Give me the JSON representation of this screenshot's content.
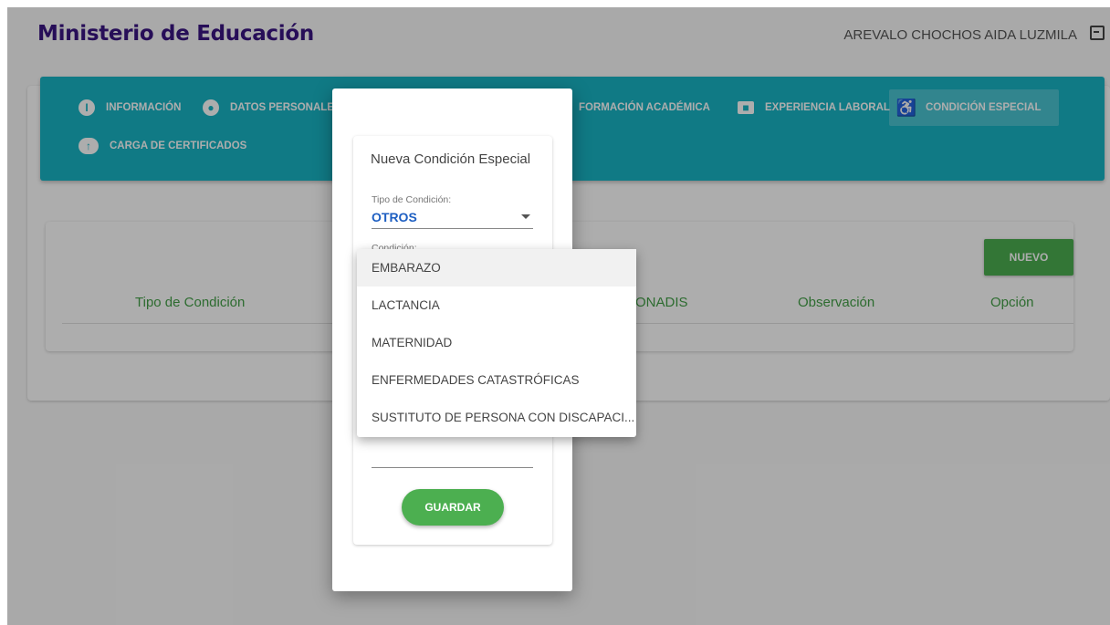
{
  "app": {
    "title": "Ministerio de Educación"
  },
  "user": {
    "name": "AREVALO CHOCHOS AIDA LUZMILA"
  },
  "tabs": [
    {
      "label": "INFORMACIÓN",
      "icon": "info-icon"
    },
    {
      "label": "DATOS PERSONALES",
      "icon": "account-circle-icon"
    },
    {
      "label": "FORMACIÓN ACADÉMICA",
      "icon": "school-icon"
    },
    {
      "label": "EXPERIENCIA LABORAL",
      "icon": "briefcase-icon"
    },
    {
      "label": "CONDICIÓN ESPECIAL",
      "icon": "accessibility-icon"
    },
    {
      "label": "CARGA DE CERTIFICADOS",
      "icon": "cloud-upload-icon"
    }
  ],
  "table": {
    "new_button": "NUEVO",
    "headers": [
      "Tipo de Condición",
      "ONADIS",
      "Observación",
      "Opción"
    ]
  },
  "dialog": {
    "title": "Nueva Condición Especial",
    "tipo_label": "Tipo de Condición:",
    "tipo_value": "OTROS",
    "condicion_label": "Condición:",
    "save_button": "GUARDAR"
  },
  "dropdown": {
    "options": [
      "EMBARAZO",
      "LACTANCIA",
      "MATERNIDAD",
      "ENFERMEDADES CATASTRÓFICAS",
      "SUSTITUTO DE PERSONA CON DISCAPACI..."
    ],
    "highlighted_index": 0
  },
  "colors": {
    "brand": "#3a1582",
    "tabbar": "#18b4c4",
    "accent_green": "#4caf50",
    "link_blue": "#1e5fc2"
  }
}
